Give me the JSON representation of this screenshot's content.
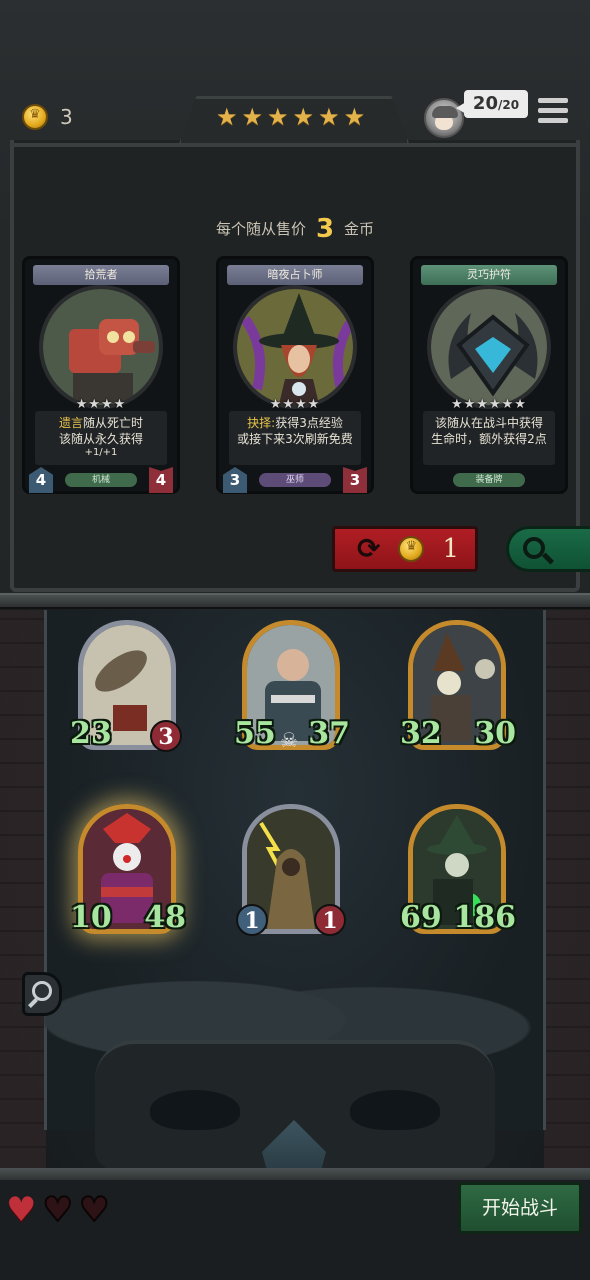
{
  "header": {
    "gold": "3",
    "tier_stars": [
      "★",
      "★",
      "★",
      "★",
      "★",
      "★"
    ],
    "lives": "20",
    "lives_max": "/20",
    "icons": {
      "coin": "coin-icon",
      "menu": "hamburger-menu-icon",
      "avatar": "player-avatar-icon"
    }
  },
  "shop": {
    "price_prefix": "每个随从售价",
    "price_value": "3",
    "price_suffix": "金币",
    "cards": [
      {
        "title": "拾荒者",
        "stars": "★★★★",
        "desc_highlight": "遗言",
        "desc_line1_rest": "随从死亡时",
        "desc_line2": "该随从永久获得",
        "desc_line3": "+1/+1",
        "tribe": "机械",
        "attack": "4",
        "health": "4"
      },
      {
        "title": "暗夜占卜师",
        "stars": "★★★★",
        "desc_highlight": "抉择:",
        "desc_line1_rest": "获得3点经验",
        "desc_line2": "或接下来3次刷新免费",
        "desc_line3": "",
        "tribe": "巫师",
        "attack": "3",
        "health": "3"
      },
      {
        "title": "灵巧护符",
        "stars": "★★★★★★",
        "desc_highlight": "",
        "desc_line1_rest": "该随从在战斗中获得",
        "desc_line2": "生命时，额外获得2点",
        "desc_line3": "",
        "tribe": "装备牌",
        "attack": "",
        "health": ""
      }
    ],
    "refresh_cost": "1",
    "colors": {
      "refresh": "#a81a20",
      "search": "#166040",
      "price_highlight": "#f2c94c"
    }
  },
  "board": {
    "minions": [
      {
        "attack": "23",
        "health": "3",
        "style": "badge-health"
      },
      {
        "attack": "55",
        "health": "37",
        "style": "skull"
      },
      {
        "attack": "32",
        "health": "30",
        "style": "plain"
      },
      {
        "attack": "10",
        "health": "48",
        "style": "plain"
      },
      {
        "attack": "1",
        "health": "1",
        "style": "badges"
      },
      {
        "attack": "69",
        "health": "186",
        "style": "plain"
      }
    ]
  },
  "footer": {
    "hearts": [
      "full",
      "empty",
      "empty"
    ],
    "start_label": "开始战斗"
  }
}
